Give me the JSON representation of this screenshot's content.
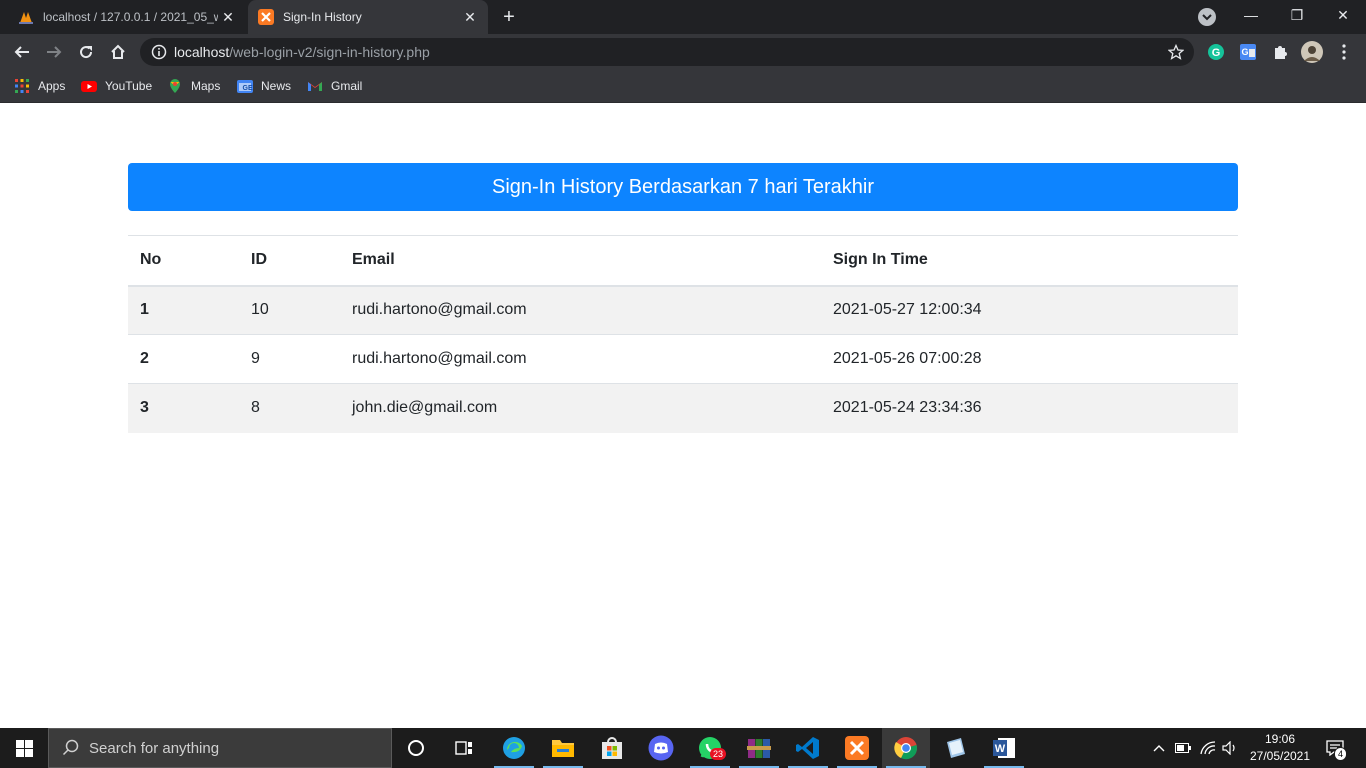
{
  "browser": {
    "tabs": [
      {
        "title": "localhost / 127.0.0.1 / 2021_05_w",
        "active": false
      },
      {
        "title": "Sign-In History",
        "active": true
      }
    ],
    "url_host": "localhost",
    "url_path": "/web-login-v2/sign-in-history.php",
    "bookmarks": [
      "Apps",
      "YouTube",
      "Maps",
      "News",
      "Gmail"
    ]
  },
  "page": {
    "header": "Sign-In History Berdasarkan 7 hari Terakhir",
    "accent_color": "#0d84ff",
    "table": {
      "columns": [
        "No",
        "ID",
        "Email",
        "Sign In Time"
      ],
      "rows": [
        {
          "no": "1",
          "id": "10",
          "email": "rudi.hartono@gmail.com",
          "time": "2021-05-27 12:00:34"
        },
        {
          "no": "2",
          "id": "9",
          "email": "rudi.hartono@gmail.com",
          "time": "2021-05-26 07:00:28"
        },
        {
          "no": "3",
          "id": "8",
          "email": "john.die@gmail.com",
          "time": "2021-05-24 23:34:36"
        }
      ]
    }
  },
  "taskbar": {
    "search_placeholder": "Search for anything",
    "whatsapp_badge": "23",
    "time": "19:06",
    "date": "27/05/2021",
    "notification_count": "4"
  }
}
